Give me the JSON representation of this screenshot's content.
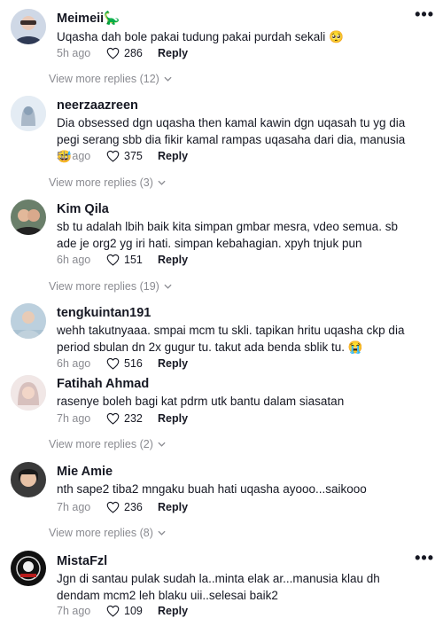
{
  "comments": [
    {
      "username": "Meimeii🦕",
      "text": "Uqasha dah bole pakai tudung pakai purdah sekali 🥺",
      "ago": "5h ago",
      "likes": "286",
      "reply_label": "Reply",
      "more_replies": "View more replies (12)",
      "has_menu": true
    },
    {
      "username": "neerzaazreen",
      "text": "Dia obsessed dgn uqasha then kamal kawin dgn uqasah tu yg dia pegi serang sbb dia fikir kamal rampas uqasaha dari dia, manusia 😅",
      "ago": "5h ago",
      "likes": "375",
      "reply_label": "Reply",
      "more_replies": "View more replies (3)"
    },
    {
      "username": "Kim Qila",
      "text": "sb tu adalah lbih baik kita simpan gmbar mesra, vdeo semua. sb ade je org2 yg iri hati. simpan kebahagian. xpyh tnjuk pun",
      "ago": "6h ago",
      "likes": "151",
      "reply_label": "Reply",
      "more_replies": "View more replies (19)"
    },
    {
      "username": "tengkuintan191",
      "text": "wehh takutnyaaa. smpai mcm tu skli. tapikan hritu uqasha ckp dia period sbulan dn 2x gugur tu. takut ada benda sblik tu. 😭",
      "ago": "6h ago",
      "likes": "516",
      "reply_label": "Reply"
    },
    {
      "username": "Fatihah Ahmad",
      "text": "rasenye boleh bagi kat pdrm utk bantu dalam siasatan",
      "ago": "7h ago",
      "likes": "232",
      "reply_label": "Reply",
      "more_replies": "View more replies (2)"
    },
    {
      "username": "Mie Amie",
      "text": "nth sape2 tiba2 mngaku buah hati uqasha ayooo...saikooo",
      "ago": "7h ago",
      "likes": "236",
      "reply_label": "Reply",
      "more_replies": "View more replies (8)"
    },
    {
      "username": "MistaFzl",
      "text": "Jgn di santau pulak sudah la..minta elak ar...manusia klau dh dendam mcm2 leh blaku uii..selesai baik2",
      "ago": "7h ago",
      "likes": "109",
      "reply_label": "Reply",
      "has_menu": true
    }
  ],
  "menu_glyph": "•••",
  "colors": {
    "text": "#161823",
    "muted": "#8a8b91",
    "background": "#ffffff"
  },
  "icons": {
    "like": "heart-outline-icon",
    "expand": "chevron-down-icon",
    "menu": "more-dots-icon"
  }
}
